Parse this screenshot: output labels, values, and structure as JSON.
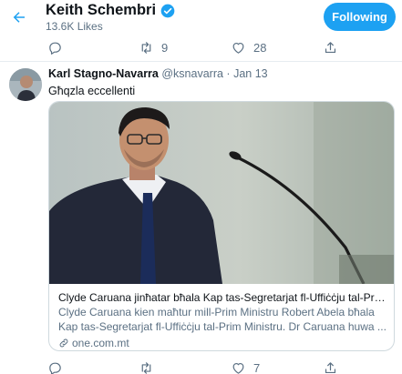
{
  "header": {
    "title": "Keith Schembri",
    "subtitle": "13.6K Likes",
    "follow_label": "Following"
  },
  "top_actions": {
    "retweets": "9",
    "likes": "28"
  },
  "tweet": {
    "author_name": "Karl Stagno-Navarra",
    "author_handle": "@ksnavarra",
    "separator": "·",
    "date": "Jan 13",
    "text": "Għqzla eccellenti",
    "card": {
      "title": "Clyde Caruana jinħatar bħala Kap tas-Segretarjat fl-Uffiċċju tal-Prim Ministru",
      "description": "Clyde Caruana kien maħtur mill-Prim Ministru Robert Abela bħala Kap tas-Segretarjat fl-Uffiċċju tal-Prim Ministru. Dr Caruana huwa ...",
      "link": "one.com.mt"
    },
    "actions": {
      "likes": "7"
    }
  },
  "colors": {
    "accent": "#1da1f2",
    "muted": "#5b7083",
    "border": "#cfd9de"
  },
  "icons": [
    "back-arrow-icon",
    "verified-badge-icon",
    "reply-icon",
    "retweet-icon",
    "like-icon",
    "share-icon",
    "link-icon"
  ]
}
